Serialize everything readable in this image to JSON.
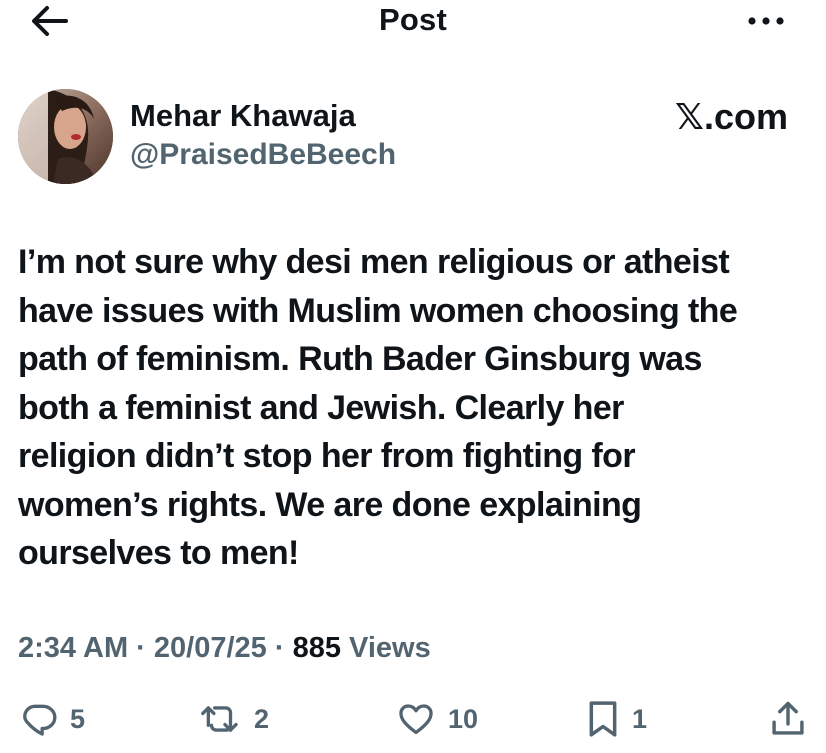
{
  "header": {
    "title": "Post",
    "back_icon": "arrow-left-icon",
    "more_icon": "more-horizontal-icon"
  },
  "author": {
    "display_name": "Mehar Khawaja",
    "handle": "@PraisedBeBeech"
  },
  "brand": "𝕏.com",
  "tweet": {
    "text": "I’m not sure why desi men religious or atheist\nhave issues with Muslim women choosing the\npath of feminism. Ruth Bader Ginsburg was\nboth a feminist and Jewish. Clearly her\nreligion didn’t stop her from fighting for\nwomen’s rights. We are done explaining\nourselves to men!"
  },
  "meta": {
    "time": "2:34 AM",
    "sep1": " · ",
    "date": "20/07/25",
    "sep2": " · ",
    "views_count": "885",
    "views_label": " Views"
  },
  "actions": {
    "replies": "5",
    "reposts": "2",
    "likes": "10",
    "bookmarks": "1"
  },
  "colors": {
    "text_primary": "#0f1419",
    "text_secondary": "#536471"
  }
}
